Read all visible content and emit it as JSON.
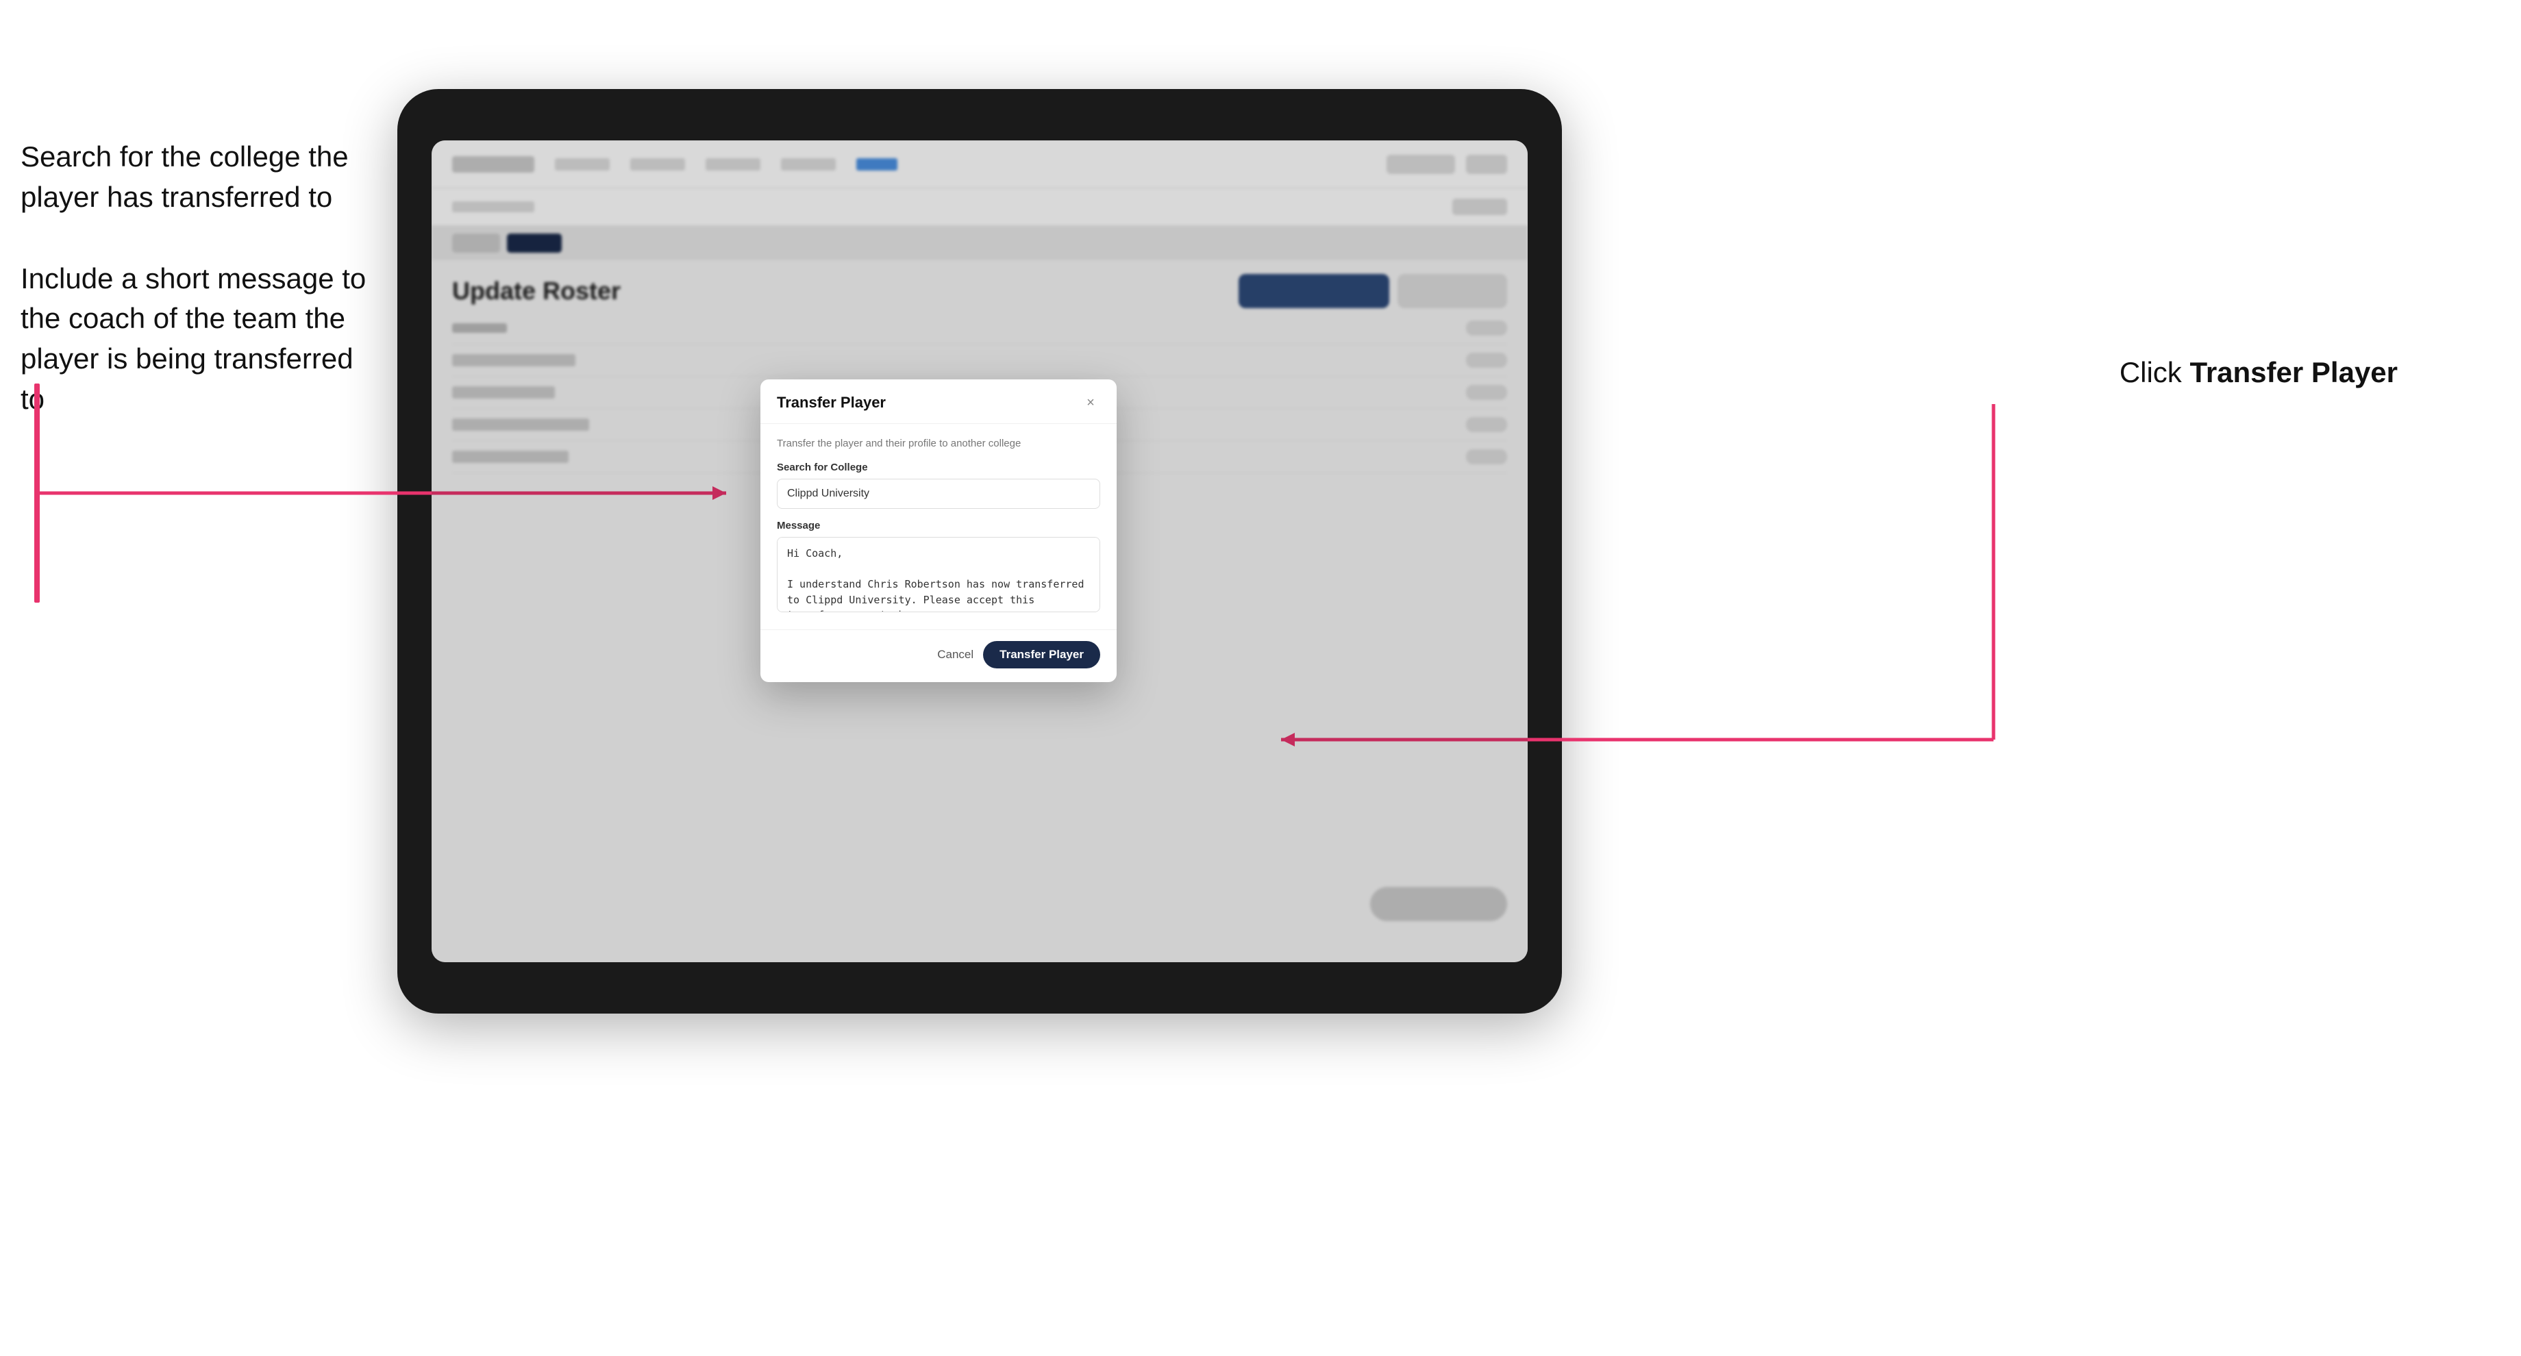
{
  "annotations": {
    "left_text_1": "Search for the college the player has transferred to",
    "left_text_2": "Include a short message to the coach of the team the player is being transferred to",
    "right_text_prefix": "Click ",
    "right_text_bold": "Transfer Player"
  },
  "tablet": {
    "app": {
      "nav_items": [
        "Community",
        "Team",
        "Statistics",
        "More Info",
        "Active"
      ],
      "sub_header": "Scheduled (11)",
      "sub_right": "Order",
      "tabs": [
        "All",
        "Active"
      ],
      "page_title": "Update Roster",
      "rows": [
        {
          "label": "Name"
        },
        {
          "label": "Chris Robertson"
        },
        {
          "label": "Ali Smith"
        },
        {
          "label": "Jordan Lee"
        },
        {
          "label": "Marcus Brown"
        },
        {
          "label": "David Wilson"
        }
      ]
    },
    "modal": {
      "title": "Transfer Player",
      "close_icon": "×",
      "description": "Transfer the player and their profile to another college",
      "search_label": "Search for College",
      "search_value": "Clippd University",
      "message_label": "Message",
      "message_value": "Hi Coach,\n\nI understand Chris Robertson has now transferred to Clippd University. Please accept this transfer request when you can.",
      "cancel_label": "Cancel",
      "transfer_label": "Transfer Player"
    }
  }
}
